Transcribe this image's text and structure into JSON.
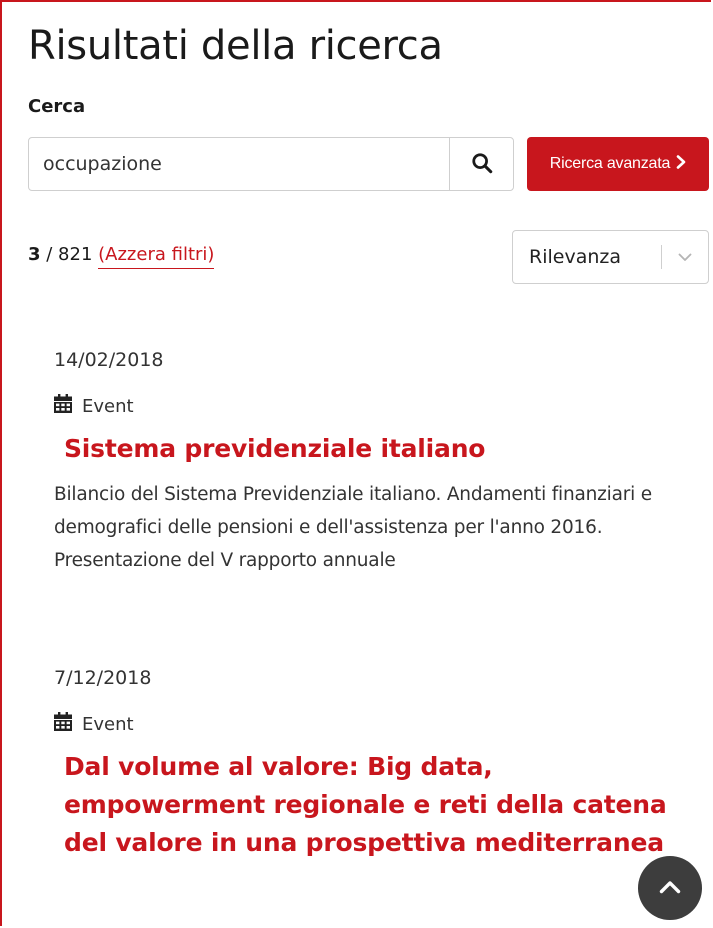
{
  "page": {
    "title": "Risultati della ricerca"
  },
  "search": {
    "label": "Cerca",
    "value": "occupazione",
    "advanced_label": "Ricerca avanzata"
  },
  "results_summary": {
    "shown": "3",
    "separator": " / ",
    "total": "821",
    "reset_label": "(Azzera filtri)"
  },
  "sort": {
    "selected": "Rilevanza"
  },
  "results": [
    {
      "date": "14/02/2018",
      "type": "Event",
      "title": "Sistema previdenziale italiano",
      "description": "Bilancio del Sistema Previdenziale italiano. Andamenti finanziari e demografici delle pensioni e dell'assistenza per l'anno 2016. Presentazione del V rapporto annuale"
    },
    {
      "date": "7/12/2018",
      "type": "Event",
      "title": "Dal volume al valore: Big data, empowerment regionale e reti della catena del valore in una prospettiva mediterranea",
      "description": ""
    }
  ],
  "colors": {
    "accent": "#c8161d",
    "scroll_button": "#3d3d3d"
  },
  "icons": {
    "search": "search-icon",
    "chevron_right": "chevron-right-icon",
    "chevron_down": "chevron-down-icon",
    "event": "calendar-icon",
    "scroll_top": "chevron-up-icon"
  }
}
